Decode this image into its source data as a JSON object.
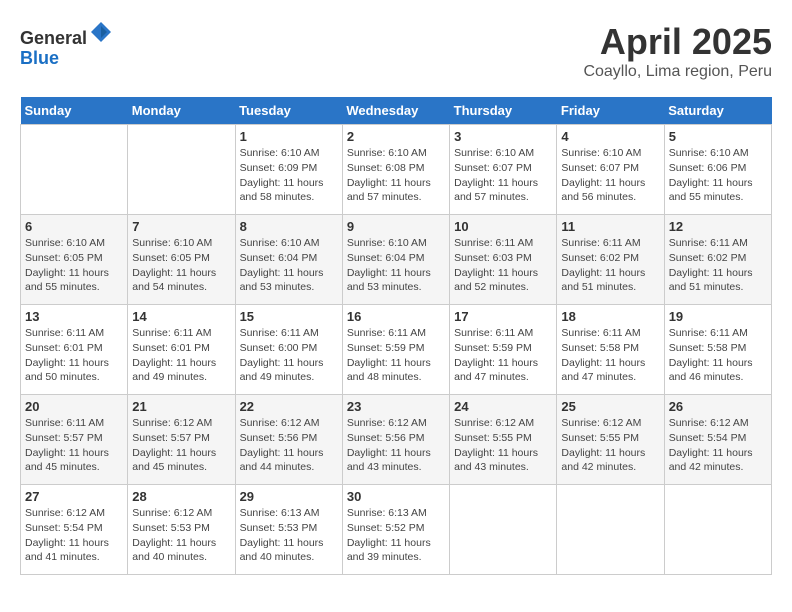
{
  "header": {
    "logo_line1": "General",
    "logo_line2": "Blue",
    "title": "April 2025",
    "subtitle": "Coayllo, Lima region, Peru"
  },
  "weekdays": [
    "Sunday",
    "Monday",
    "Tuesday",
    "Wednesday",
    "Thursday",
    "Friday",
    "Saturday"
  ],
  "weeks": [
    [
      {
        "day": "",
        "detail": ""
      },
      {
        "day": "",
        "detail": ""
      },
      {
        "day": "1",
        "detail": "Sunrise: 6:10 AM\nSunset: 6:09 PM\nDaylight: 11 hours\nand 58 minutes."
      },
      {
        "day": "2",
        "detail": "Sunrise: 6:10 AM\nSunset: 6:08 PM\nDaylight: 11 hours\nand 57 minutes."
      },
      {
        "day": "3",
        "detail": "Sunrise: 6:10 AM\nSunset: 6:07 PM\nDaylight: 11 hours\nand 57 minutes."
      },
      {
        "day": "4",
        "detail": "Sunrise: 6:10 AM\nSunset: 6:07 PM\nDaylight: 11 hours\nand 56 minutes."
      },
      {
        "day": "5",
        "detail": "Sunrise: 6:10 AM\nSunset: 6:06 PM\nDaylight: 11 hours\nand 55 minutes."
      }
    ],
    [
      {
        "day": "6",
        "detail": "Sunrise: 6:10 AM\nSunset: 6:05 PM\nDaylight: 11 hours\nand 55 minutes."
      },
      {
        "day": "7",
        "detail": "Sunrise: 6:10 AM\nSunset: 6:05 PM\nDaylight: 11 hours\nand 54 minutes."
      },
      {
        "day": "8",
        "detail": "Sunrise: 6:10 AM\nSunset: 6:04 PM\nDaylight: 11 hours\nand 53 minutes."
      },
      {
        "day": "9",
        "detail": "Sunrise: 6:10 AM\nSunset: 6:04 PM\nDaylight: 11 hours\nand 53 minutes."
      },
      {
        "day": "10",
        "detail": "Sunrise: 6:11 AM\nSunset: 6:03 PM\nDaylight: 11 hours\nand 52 minutes."
      },
      {
        "day": "11",
        "detail": "Sunrise: 6:11 AM\nSunset: 6:02 PM\nDaylight: 11 hours\nand 51 minutes."
      },
      {
        "day": "12",
        "detail": "Sunrise: 6:11 AM\nSunset: 6:02 PM\nDaylight: 11 hours\nand 51 minutes."
      }
    ],
    [
      {
        "day": "13",
        "detail": "Sunrise: 6:11 AM\nSunset: 6:01 PM\nDaylight: 11 hours\nand 50 minutes."
      },
      {
        "day": "14",
        "detail": "Sunrise: 6:11 AM\nSunset: 6:01 PM\nDaylight: 11 hours\nand 49 minutes."
      },
      {
        "day": "15",
        "detail": "Sunrise: 6:11 AM\nSunset: 6:00 PM\nDaylight: 11 hours\nand 49 minutes."
      },
      {
        "day": "16",
        "detail": "Sunrise: 6:11 AM\nSunset: 5:59 PM\nDaylight: 11 hours\nand 48 minutes."
      },
      {
        "day": "17",
        "detail": "Sunrise: 6:11 AM\nSunset: 5:59 PM\nDaylight: 11 hours\nand 47 minutes."
      },
      {
        "day": "18",
        "detail": "Sunrise: 6:11 AM\nSunset: 5:58 PM\nDaylight: 11 hours\nand 47 minutes."
      },
      {
        "day": "19",
        "detail": "Sunrise: 6:11 AM\nSunset: 5:58 PM\nDaylight: 11 hours\nand 46 minutes."
      }
    ],
    [
      {
        "day": "20",
        "detail": "Sunrise: 6:11 AM\nSunset: 5:57 PM\nDaylight: 11 hours\nand 45 minutes."
      },
      {
        "day": "21",
        "detail": "Sunrise: 6:12 AM\nSunset: 5:57 PM\nDaylight: 11 hours\nand 45 minutes."
      },
      {
        "day": "22",
        "detail": "Sunrise: 6:12 AM\nSunset: 5:56 PM\nDaylight: 11 hours\nand 44 minutes."
      },
      {
        "day": "23",
        "detail": "Sunrise: 6:12 AM\nSunset: 5:56 PM\nDaylight: 11 hours\nand 43 minutes."
      },
      {
        "day": "24",
        "detail": "Sunrise: 6:12 AM\nSunset: 5:55 PM\nDaylight: 11 hours\nand 43 minutes."
      },
      {
        "day": "25",
        "detail": "Sunrise: 6:12 AM\nSunset: 5:55 PM\nDaylight: 11 hours\nand 42 minutes."
      },
      {
        "day": "26",
        "detail": "Sunrise: 6:12 AM\nSunset: 5:54 PM\nDaylight: 11 hours\nand 42 minutes."
      }
    ],
    [
      {
        "day": "27",
        "detail": "Sunrise: 6:12 AM\nSunset: 5:54 PM\nDaylight: 11 hours\nand 41 minutes."
      },
      {
        "day": "28",
        "detail": "Sunrise: 6:12 AM\nSunset: 5:53 PM\nDaylight: 11 hours\nand 40 minutes."
      },
      {
        "day": "29",
        "detail": "Sunrise: 6:13 AM\nSunset: 5:53 PM\nDaylight: 11 hours\nand 40 minutes."
      },
      {
        "day": "30",
        "detail": "Sunrise: 6:13 AM\nSunset: 5:52 PM\nDaylight: 11 hours\nand 39 minutes."
      },
      {
        "day": "",
        "detail": ""
      },
      {
        "day": "",
        "detail": ""
      },
      {
        "day": "",
        "detail": ""
      }
    ]
  ]
}
